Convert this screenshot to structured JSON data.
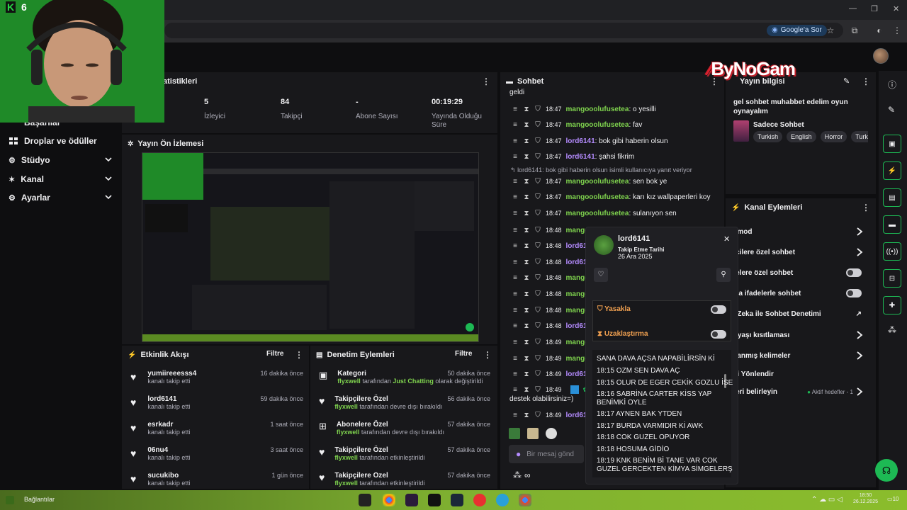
{
  "browser": {
    "google_sor": "Google'a Sor"
  },
  "webcam": {
    "badge": "6"
  },
  "sidebar": {
    "items": [
      {
        "label": "Başarılar"
      },
      {
        "label": "Droplar ve ödüller"
      },
      {
        "label": "Stüdyo"
      },
      {
        "label": "Kanal"
      },
      {
        "label": "Ayarlar"
      }
    ]
  },
  "stats": {
    "title": "atistikleri",
    "items": [
      {
        "value": "5",
        "label": "İzleyici"
      },
      {
        "value": "84",
        "label": "Takipçi"
      },
      {
        "value": "-",
        "label": "Abone Sayısı"
      },
      {
        "value": "00:19:29",
        "label": "Yayında Olduğu Süre"
      }
    ]
  },
  "preview": {
    "title": "Yayın Ön İzlemesi"
  },
  "activity": {
    "title": "Etkinlik Akışı",
    "filter": "Filtre",
    "items": [
      {
        "name": "yumiireeesss4",
        "sub": "kanalı takip etti",
        "time": "16 dakika önce"
      },
      {
        "name": "lord6141",
        "sub": "kanalı takip etti",
        "time": "59 dakika önce"
      },
      {
        "name": "esrkadr",
        "sub": "kanalı takip etti",
        "time": "1 saat önce"
      },
      {
        "name": "06nu4",
        "sub": "kanalı takip etti",
        "time": "3 saat önce"
      },
      {
        "name": "sucukibo",
        "sub": "kanalı takip etti",
        "time": "1 gün önce"
      }
    ]
  },
  "moderation": {
    "title": "Denetim Eylemleri",
    "filter": "Filtre",
    "items": [
      {
        "title": "Kategori",
        "actor": "flyxwell",
        "mid": " tarafından ",
        "highlight": "Just Chatting",
        "rest": " olarak değiştirildi",
        "time": "50 dakika önce"
      },
      {
        "title": "Takipçilere Özel",
        "actor": "flyxwell",
        "mid": " tarafından devre dışı bırakıldı",
        "highlight": "",
        "rest": "",
        "time": "56 dakika önce"
      },
      {
        "title": "Abonelere Özel",
        "actor": "flyxwell",
        "mid": " tarafından devre dışı bırakıldı",
        "highlight": "",
        "rest": "",
        "time": "57 dakika önce"
      },
      {
        "title": "Takipçilere Özel",
        "actor": "flyxwell",
        "mid": " tarafından etkinleştirildi",
        "highlight": "",
        "rest": "",
        "time": "57 dakika önce"
      },
      {
        "title": "Takipçilere Özel",
        "actor": "flyxwell",
        "mid": " tarafından etkinleştirildi",
        "highlight": "",
        "rest": "",
        "time": "57 dakika önce"
      }
    ]
  },
  "chat": {
    "title": "Sohbet",
    "top_text": "geldi",
    "lines": [
      {
        "time": "18:47",
        "user": "mangooolufusetea",
        "msg": ": o yesilli",
        "color": "green"
      },
      {
        "time": "18:47",
        "user": "mangooolufusetea",
        "msg": ": fav",
        "color": "green"
      },
      {
        "time": "18:47",
        "user": "lord6141",
        "msg": ": bok gibi haberin olsun",
        "color": "purple"
      },
      {
        "time": "18:47",
        "user": "lord6141",
        "msg": ": şahsi fikrim",
        "color": "purple"
      }
    ],
    "reply_note": "lord6141: bok gibi haberin olsun isimli kullanıcıya yanıt veriyor",
    "lines2": [
      {
        "time": "18:47",
        "user": "mangooolufusetea",
        "msg": ": sen bok ye",
        "color": "green"
      },
      {
        "time": "18:47",
        "user": "mangooolufusetea",
        "msg": ": karı kız wallpaperleri koy",
        "color": "green"
      },
      {
        "time": "18:47",
        "user": "mangooolufusetea",
        "msg": ": sulanıyon sen",
        "color": "green"
      },
      {
        "time": "18:48",
        "user": "mango",
        "msg": "",
        "color": "green"
      },
      {
        "time": "18:48",
        "user": "lord61",
        "msg": "",
        "color": "purple"
      },
      {
        "time": "18:48",
        "user": "lord61",
        "msg": "",
        "color": "purple"
      },
      {
        "time": "18:48",
        "user": "mango",
        "msg": "",
        "color": "green"
      },
      {
        "time": "18:48",
        "user": "mango",
        "msg": "",
        "color": "green"
      },
      {
        "time": "18:48",
        "user": "mango",
        "msg": "",
        "color": "green"
      },
      {
        "time": "18:48",
        "user": "lord61",
        "msg": "",
        "color": "purple"
      },
      {
        "time": "18:49",
        "user": "mango",
        "msg": "",
        "color": "green"
      },
      {
        "time": "18:49",
        "user": "mango",
        "msg": "",
        "color": "green"
      },
      {
        "time": "18:49",
        "user": "lord61",
        "msg": "",
        "color": "purple"
      },
      {
        "time": "18:49",
        "user": "",
        "msg": "",
        "color": "green"
      }
    ],
    "wrap_text": "destek olabilirsiniz=)",
    "last": {
      "time": "18:49",
      "user": "lord61",
      "color": "purple"
    },
    "input_placeholder": "Bir mesaj gönd",
    "points": "∞"
  },
  "popup": {
    "username": "lord6141",
    "follow_label": "Takip Etme Tarihi",
    "follow_date": "26 Ara 2025",
    "ban": "Yasakla",
    "timeout": "Uzaklaştırma",
    "messages": [
      "SANA DAVA AÇSA NAPABİLİRSİN Kİ",
      "18:15 OZM SEN DAVA AÇ",
      "18:15 OLUR DE EGER CEKİK GOZLU İSE",
      "18:16 SABRİNA CARTER KİSS YAP",
      "BENİMKİ OYLE",
      "18:17 AYNEN BAK YTDEN",
      "18:17 BURDA VARMIDIR Kİ AWK",
      "18:18 COK GUZEL OPUYOR",
      "18:18 HOSUMA GİDİO",
      "18:19 KNK BENİM Bİ TANE VAR COK",
      "GUZEL GERCEKTEN KİMYA SİMGELERŞ"
    ]
  },
  "stream_info": {
    "title": "Yayın bilgisi",
    "description": "gel sohbet muhabbet edelim oyun oynayalım",
    "category": "Sadece Sohbet",
    "tags": [
      "Turkish",
      "English",
      "Horror",
      "Turkst"
    ]
  },
  "channel_actions": {
    "title": "Kanal Eylemleri",
    "rows": [
      {
        "label": "ş mod",
        "control": "arrow"
      },
      {
        "label": "pçilere özel sohbet",
        "control": "arrow"
      },
      {
        "label": "nelere özel sohbet",
        "control": "toggle"
      },
      {
        "label": "zca ifadelerle sohbet",
        "control": "toggle"
      },
      {
        "label": "y Zeka ile Sohbet Denetimi",
        "control": "link"
      },
      {
        "label": "p yaşı kısıtlaması",
        "control": "arrow"
      },
      {
        "label": "klanmış kelimeler",
        "control": "arrow"
      },
      {
        "label": "ici Yönlendir",
        "control": "none"
      },
      {
        "label": "fleri belirleyin",
        "control": "goal"
      }
    ],
    "goal_text": "Aktif hedefler - 1"
  },
  "overlay": {
    "brand": "ByNoGam"
  },
  "taskbar": {
    "left_text": "Bağlantılar",
    "time": "18:50",
    "date": "26.12.2025",
    "notif": "10"
  },
  "colors": {
    "accent_green": "#7fd34e",
    "purple_name": "#b58cff",
    "panel": "#18181b",
    "bg": "#0e0e10"
  }
}
